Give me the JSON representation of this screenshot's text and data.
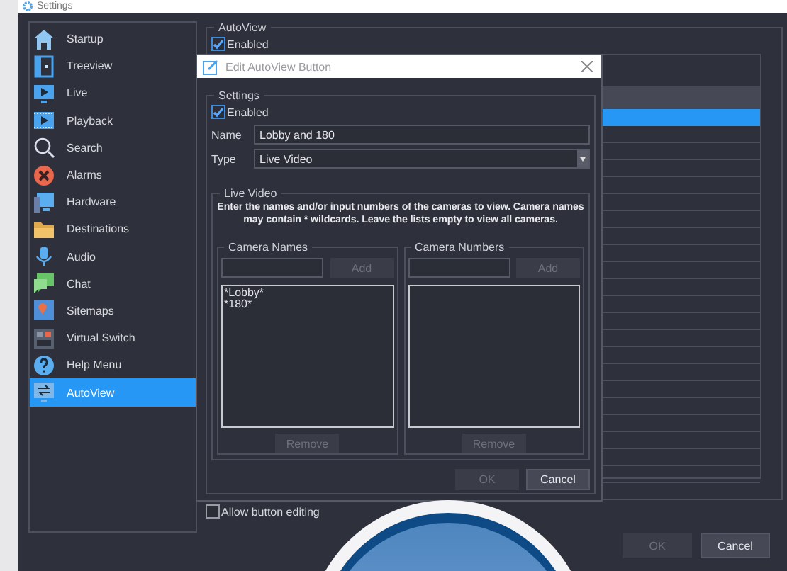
{
  "window": {
    "title": "Settings"
  },
  "sidebar": {
    "items": [
      {
        "label": "Startup",
        "selected": false
      },
      {
        "label": "Treeview",
        "selected": false
      },
      {
        "label": "Live",
        "selected": false
      },
      {
        "label": "Playback",
        "selected": false
      },
      {
        "label": "Search",
        "selected": false
      },
      {
        "label": "Alarms",
        "selected": false
      },
      {
        "label": "Hardware",
        "selected": false
      },
      {
        "label": "Destinations",
        "selected": false
      },
      {
        "label": "Audio",
        "selected": false
      },
      {
        "label": "Chat",
        "selected": false
      },
      {
        "label": "Sitemaps",
        "selected": false
      },
      {
        "label": "Virtual Switch",
        "selected": false
      },
      {
        "label": "Help Menu",
        "selected": false
      },
      {
        "label": "AutoView",
        "selected": true
      }
    ]
  },
  "autoview": {
    "title": "AutoView",
    "enabled_label": "Enabled",
    "enabled": true,
    "table": {
      "rows": [
        {
          "selected": true
        },
        {
          "selected": false
        },
        {
          "selected": false
        },
        {
          "selected": false
        },
        {
          "selected": false
        },
        {
          "selected": false
        },
        {
          "selected": false
        },
        {
          "selected": false
        },
        {
          "selected": false
        },
        {
          "selected": false
        },
        {
          "selected": false
        },
        {
          "selected": false
        },
        {
          "selected": false
        },
        {
          "selected": false
        },
        {
          "selected": false
        },
        {
          "selected": false
        },
        {
          "selected": false
        },
        {
          "selected": false
        },
        {
          "selected": false
        },
        {
          "selected": false
        },
        {
          "selected": false
        },
        {
          "selected": false
        }
      ]
    }
  },
  "allow_editing": {
    "label": "Allow button editing",
    "checked": false
  },
  "buttons": [
    {
      "label": "OK",
      "disabled": true
    },
    {
      "label": "Cancel",
      "disabled": false
    }
  ],
  "dialog": {
    "title": "Edit AutoView Button",
    "settings": {
      "title": "Settings",
      "enabled_label": "Enabled",
      "enabled": true,
      "name_label": "Name",
      "name": "Lobby and 180",
      "type_label": "Type",
      "type": "Live Video"
    },
    "live_video": {
      "title": "Live Video",
      "instructions": "Enter the names and/or input numbers of the cameras to view. Camera names may contain * wildcards. Leave the lists empty to view all cameras.",
      "lists": [
        {
          "title": "Camera Names",
          "add": {
            "label": "Add",
            "disabled": true
          },
          "items": [
            "*Lobby*",
            "*180*"
          ],
          "remove": {
            "label": "Remove",
            "disabled": true
          }
        },
        {
          "title": "Camera Numbers",
          "add": {
            "label": "Add",
            "disabled": true
          },
          "remove": {
            "label": "Remove",
            "disabled": true
          }
        }
      ]
    },
    "buttons": [
      {
        "label": "OK",
        "disabled": true
      },
      {
        "label": "Cancel",
        "disabled": false
      }
    ]
  }
}
